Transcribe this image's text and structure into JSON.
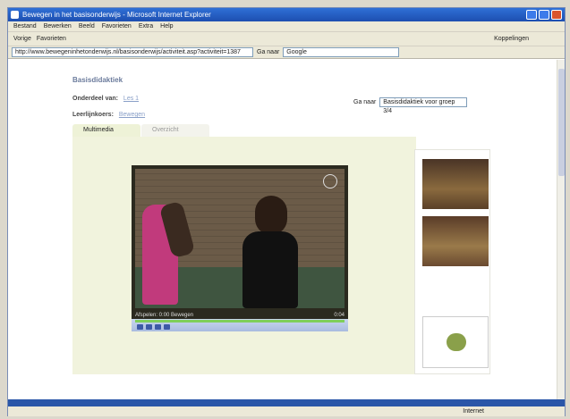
{
  "window": {
    "title": "Bewegen in het basisonderwijs - Microsoft Internet Explorer"
  },
  "menu": [
    "Bestand",
    "Bewerken",
    "Beeld",
    "Favorieten",
    "Extra",
    "Help"
  ],
  "toolbar": {
    "back": "Vorige",
    "favorites": "Favorieten",
    "right": "Koppelingen"
  },
  "address": {
    "url": "http://www.bewegeninhetonderwijs.nl/basisonderwijs/activiteit.asp?activiteit=1387",
    "go": "Ga naar",
    "google": "Google"
  },
  "page": {
    "breadcrumb": "Basisdidaktiek",
    "meta_label_1": "Onderdeel van:",
    "meta_link_1": "Les 1",
    "meta_label_2": "Leerlijnkoers:",
    "meta_link_2": "Bewegen",
    "goto_label": "Ga naar",
    "goto_value": "Basisdidaktiek voor groep 3/4",
    "tabs": [
      {
        "label": "Multimedia"
      },
      {
        "label": "Overzicht"
      }
    ],
    "video_caption": "Afspelen: 0:00 Bewegen",
    "video_time": "0:04"
  },
  "status": {
    "zone": "Internet"
  }
}
